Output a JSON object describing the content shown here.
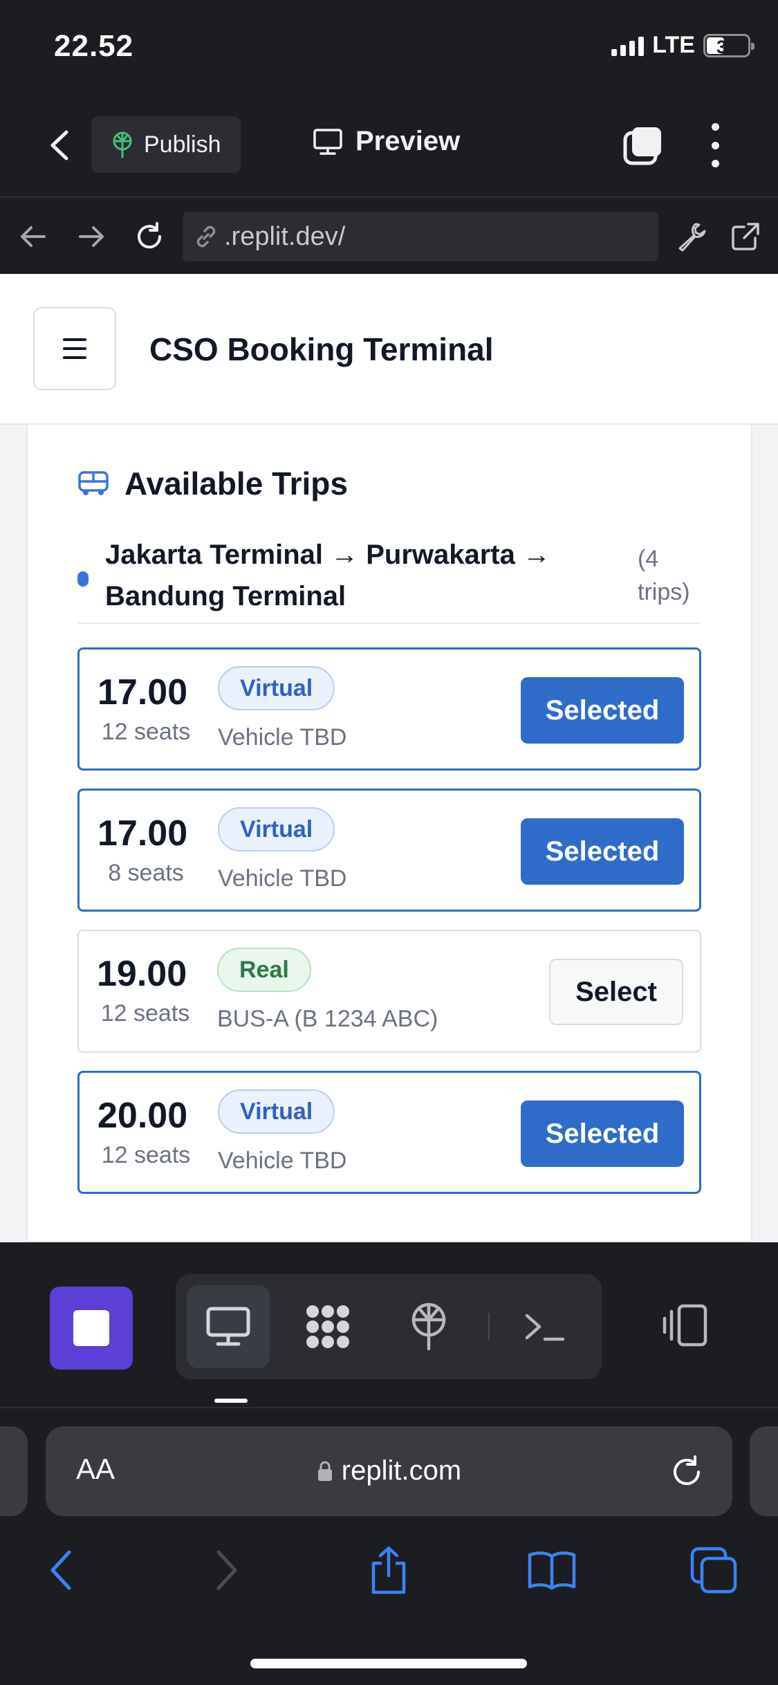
{
  "status_bar": {
    "time": "22.52",
    "network": "LTE",
    "battery": "35"
  },
  "replit_toolbar": {
    "publish_label": "Publish",
    "preview_label": "Preview"
  },
  "dev_url": {
    "url": ".replit.dev/"
  },
  "app": {
    "title": "CSO Booking Terminal",
    "section_title": "Available Trips",
    "route": {
      "name": "Jakarta Terminal → Purwakarta → Bandung Terminal",
      "count": "(4 trips)"
    },
    "trips": [
      {
        "time": "17.00",
        "seats": "12 seats",
        "badge": "Virtual",
        "vehicle": "Vehicle TBD",
        "button": "Selected"
      },
      {
        "time": "17.00",
        "seats": "8 seats",
        "badge": "Virtual",
        "vehicle": "Vehicle TBD",
        "button": "Selected"
      },
      {
        "time": "19.00",
        "seats": "12 seats",
        "badge": "Real",
        "vehicle": "BUS-A (B 1234 ABC)",
        "button": "Select"
      },
      {
        "time": "20.00",
        "seats": "12 seats",
        "badge": "Virtual",
        "vehicle": "Vehicle TBD",
        "button": "Selected"
      }
    ]
  },
  "safari": {
    "aa_label": "AA",
    "domain": "replit.com"
  },
  "colors": {
    "primary_blue": "#2f6cc9",
    "stop_purple": "#5b3fd6",
    "virtual_badge_text": "#2f62c2",
    "real_badge_text": "#2a7a45",
    "dark_chrome": "#1c1d21"
  }
}
